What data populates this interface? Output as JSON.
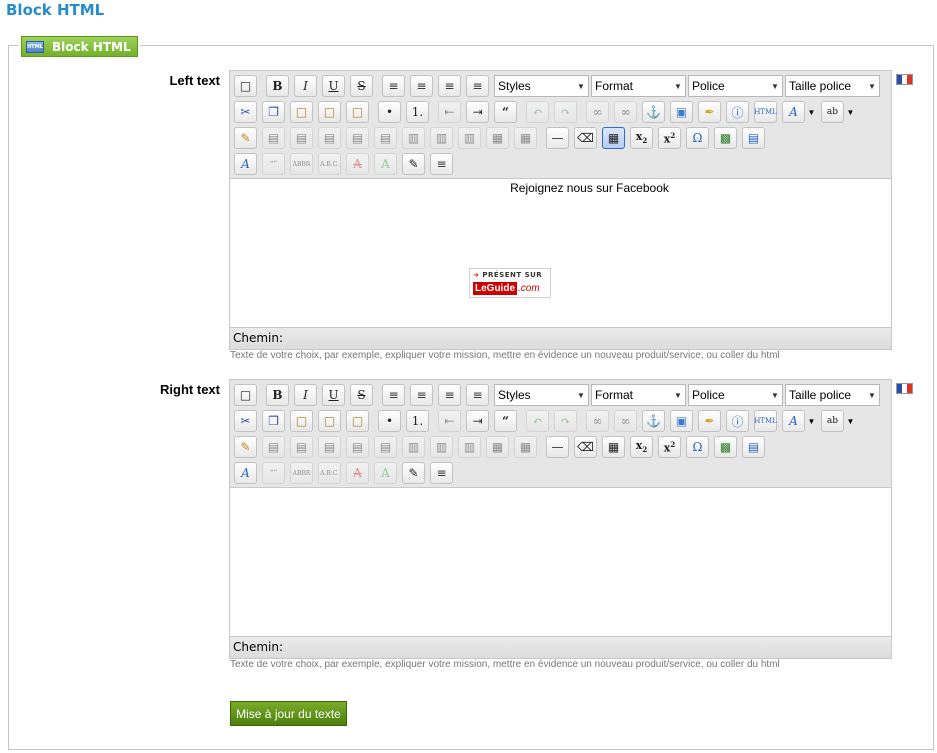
{
  "page": {
    "title": "Block HTML"
  },
  "fieldset": {
    "legend": "Block HTML",
    "legend_icon": "HTML"
  },
  "toolbar": {
    "styles": "Styles",
    "format": "Format",
    "police": "Police",
    "taille": "Taille police"
  },
  "editors": [
    {
      "label": "Left text",
      "path_label": "Chemin:",
      "content": {
        "text": "Rejoignez nous sur Facebook",
        "badge_top": "PRÉSENT SUR",
        "badge_brand": "LeGuide",
        "badge_suffix": ".com"
      },
      "help": "Texte de votre choix, par exemple, expliquer votre mission, mettre en évidence un nouveau produit/service, ou coller du html"
    },
    {
      "label": "Right text",
      "path_label": "Chemin:",
      "content": {
        "text": ""
      },
      "help": "Texte de votre choix, par exemple, expliquer votre mission, mettre en évidence un nouveau produit/service, ou coller du html"
    }
  ],
  "submit_label": "Mise à jour du texte",
  "colors": {
    "title": "#268ccd",
    "legend_green": "#73b02a",
    "submit_green": "#4e7f0e"
  }
}
